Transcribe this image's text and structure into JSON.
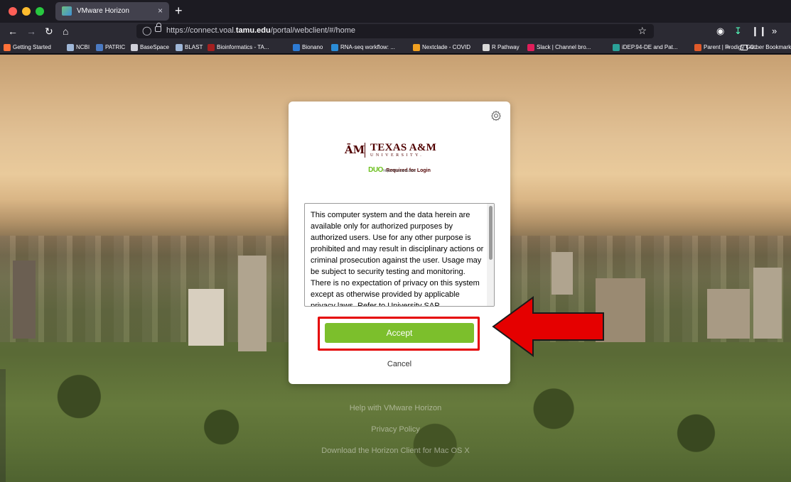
{
  "browser": {
    "tab_title": "VMware Horizon",
    "tab_close": "×",
    "new_tab": "+",
    "url_host_prefix": "https://connect.voal.",
    "url_host_bold": "tamu.edu",
    "url_path": "/portal/webclient/#/home",
    "bookmarks": [
      {
        "label": "Getting Started",
        "color": "#ff7139"
      },
      {
        "label": "NCBI",
        "color": "#9fb7d8"
      },
      {
        "label": "PATRIC",
        "color": "#4b7ac2"
      },
      {
        "label": "BaseSpace",
        "color": "#cfcfd8"
      },
      {
        "label": "BLAST",
        "color": "#9fb7d8"
      },
      {
        "label": "Bioinformatics - TA...",
        "color": "#a31f1f"
      },
      {
        "label": "Bionano",
        "color": "#2d7bd4"
      },
      {
        "label": "RNA-seq workflow: ...",
        "color": "#2b8cd6"
      },
      {
        "label": "Nextclade - COVID",
        "color": "#f0a020"
      },
      {
        "label": "R Pathway",
        "color": "#d8d8d8"
      },
      {
        "label": "Slack | Channel bro...",
        "color": "#e01e5a"
      },
      {
        "label": "iDEP.94-DE and Pat...",
        "color": "#2aa198"
      },
      {
        "label": "Parent | Prodigy Ga...",
        "color": "#e05a2a"
      }
    ],
    "bookmarks_overflow": "»",
    "other_bookmarks": "Other Bookmarks"
  },
  "dialog": {
    "logo_mark": "ĀM",
    "university_name": "TEXAS A&M",
    "university_sub": "UNIVERSITY.",
    "duo_logo": "DUO",
    "duo_required": "Required for Login",
    "duo_url": "https://duo.tamu.edu",
    "terms_text": "This computer system and the data herein are available only for authorized purposes by authorized users. Use for any other purpose is prohibited and may result in disciplinary actions or criminal prosecution against the user. Usage may be subject to security testing and monitoring. There is no expectation of privacy on this system except as otherwise provided by applicable privacy laws. Refer to University SAP",
    "accept_label": "Accept",
    "cancel_label": "Cancel"
  },
  "footer": {
    "help_link": "Help with VMware Horizon",
    "privacy_link": "Privacy Policy",
    "download_link": "Download the Horizon Client for Mac OS X"
  },
  "colors": {
    "accept_green": "#7cbf2c",
    "highlight_red": "#e50000",
    "tamu_maroon": "#500000"
  }
}
